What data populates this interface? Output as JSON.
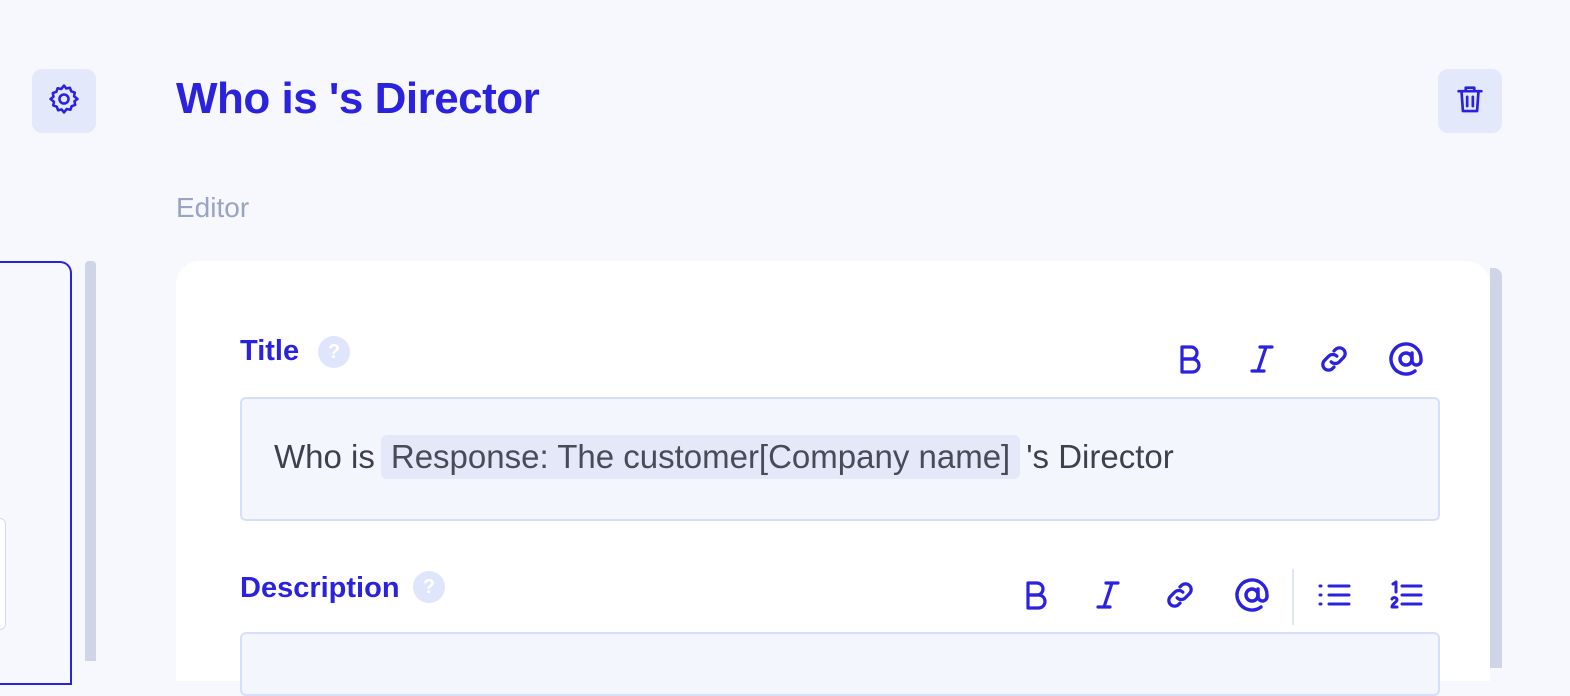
{
  "header": {
    "title": "Who is 's Director",
    "settings_icon": "gear-icon",
    "delete_icon": "trash-icon"
  },
  "section": {
    "label": "Editor"
  },
  "fields": {
    "title": {
      "label": "Title",
      "help": "?",
      "value_prefix": "Who is",
      "mention_chip": "Response: The customer[Company name]",
      "value_suffix": "'s Director",
      "toolbar": [
        "bold-icon",
        "italic-icon",
        "link-icon",
        "mention-icon"
      ]
    },
    "description": {
      "label": "Description",
      "help": "?",
      "toolbar": [
        "bold-icon",
        "italic-icon",
        "link-icon",
        "mention-icon",
        "bullet-list-icon",
        "numbered-list-icon"
      ]
    }
  },
  "colors": {
    "accent": "#2a22dc",
    "background": "#f7f8fd",
    "icon_button_bg": "#e3e8fa",
    "muted_text": "#98a3c5",
    "input_bg": "#f4f6fd",
    "input_border": "#d6defa"
  }
}
